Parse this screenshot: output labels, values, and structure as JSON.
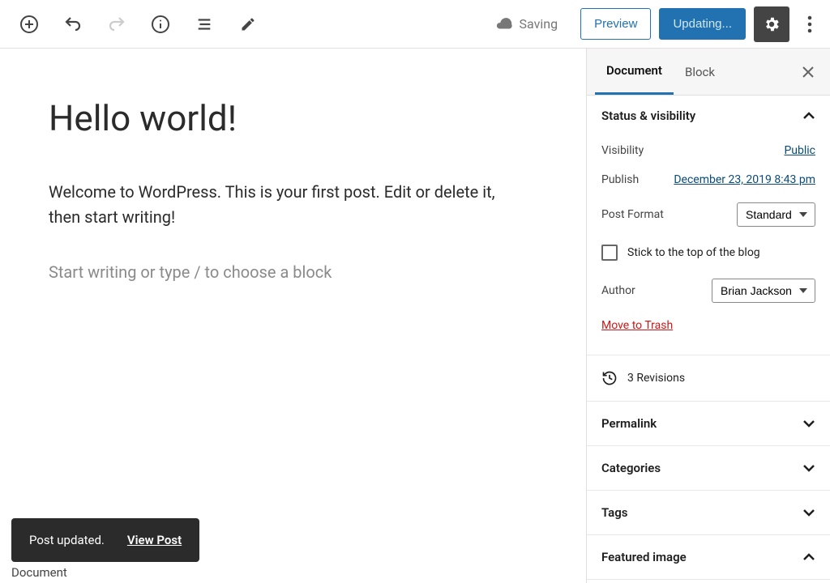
{
  "toolbar": {
    "saving_label": "Saving",
    "preview_label": "Preview",
    "updating_label": "Updating...",
    "icons": {
      "add": "add-icon",
      "undo": "undo-icon",
      "redo": "redo-icon",
      "info": "info-icon",
      "outline": "outline-icon",
      "edit": "edit-icon",
      "cloud": "cloud-icon",
      "gear": "gear-icon",
      "more": "more-icon"
    }
  },
  "editor": {
    "title": "Hello world!",
    "body": "Welcome to WordPress. This is your first post. Edit or delete it, then start writing!",
    "placeholder": "Start writing or type / to choose a block"
  },
  "sidebar": {
    "tabs": {
      "document": "Document",
      "block": "Block"
    },
    "status_visibility": {
      "title": "Status & visibility",
      "visibility_label": "Visibility",
      "visibility_value": "Public",
      "publish_label": "Publish",
      "publish_value": "December 23, 2019 8:43 pm",
      "post_format_label": "Post Format",
      "post_format_value": "Standard",
      "stick_label": "Stick to the top of the blog",
      "author_label": "Author",
      "author_value": "Brian Jackson",
      "trash_label": "Move to Trash"
    },
    "revisions_label": "3 Revisions",
    "panels": {
      "permalink": "Permalink",
      "categories": "Categories",
      "tags": "Tags",
      "featured_image": "Featured image"
    }
  },
  "toast": {
    "message": "Post updated.",
    "action": "View Post"
  },
  "footer_hint": "Document"
}
